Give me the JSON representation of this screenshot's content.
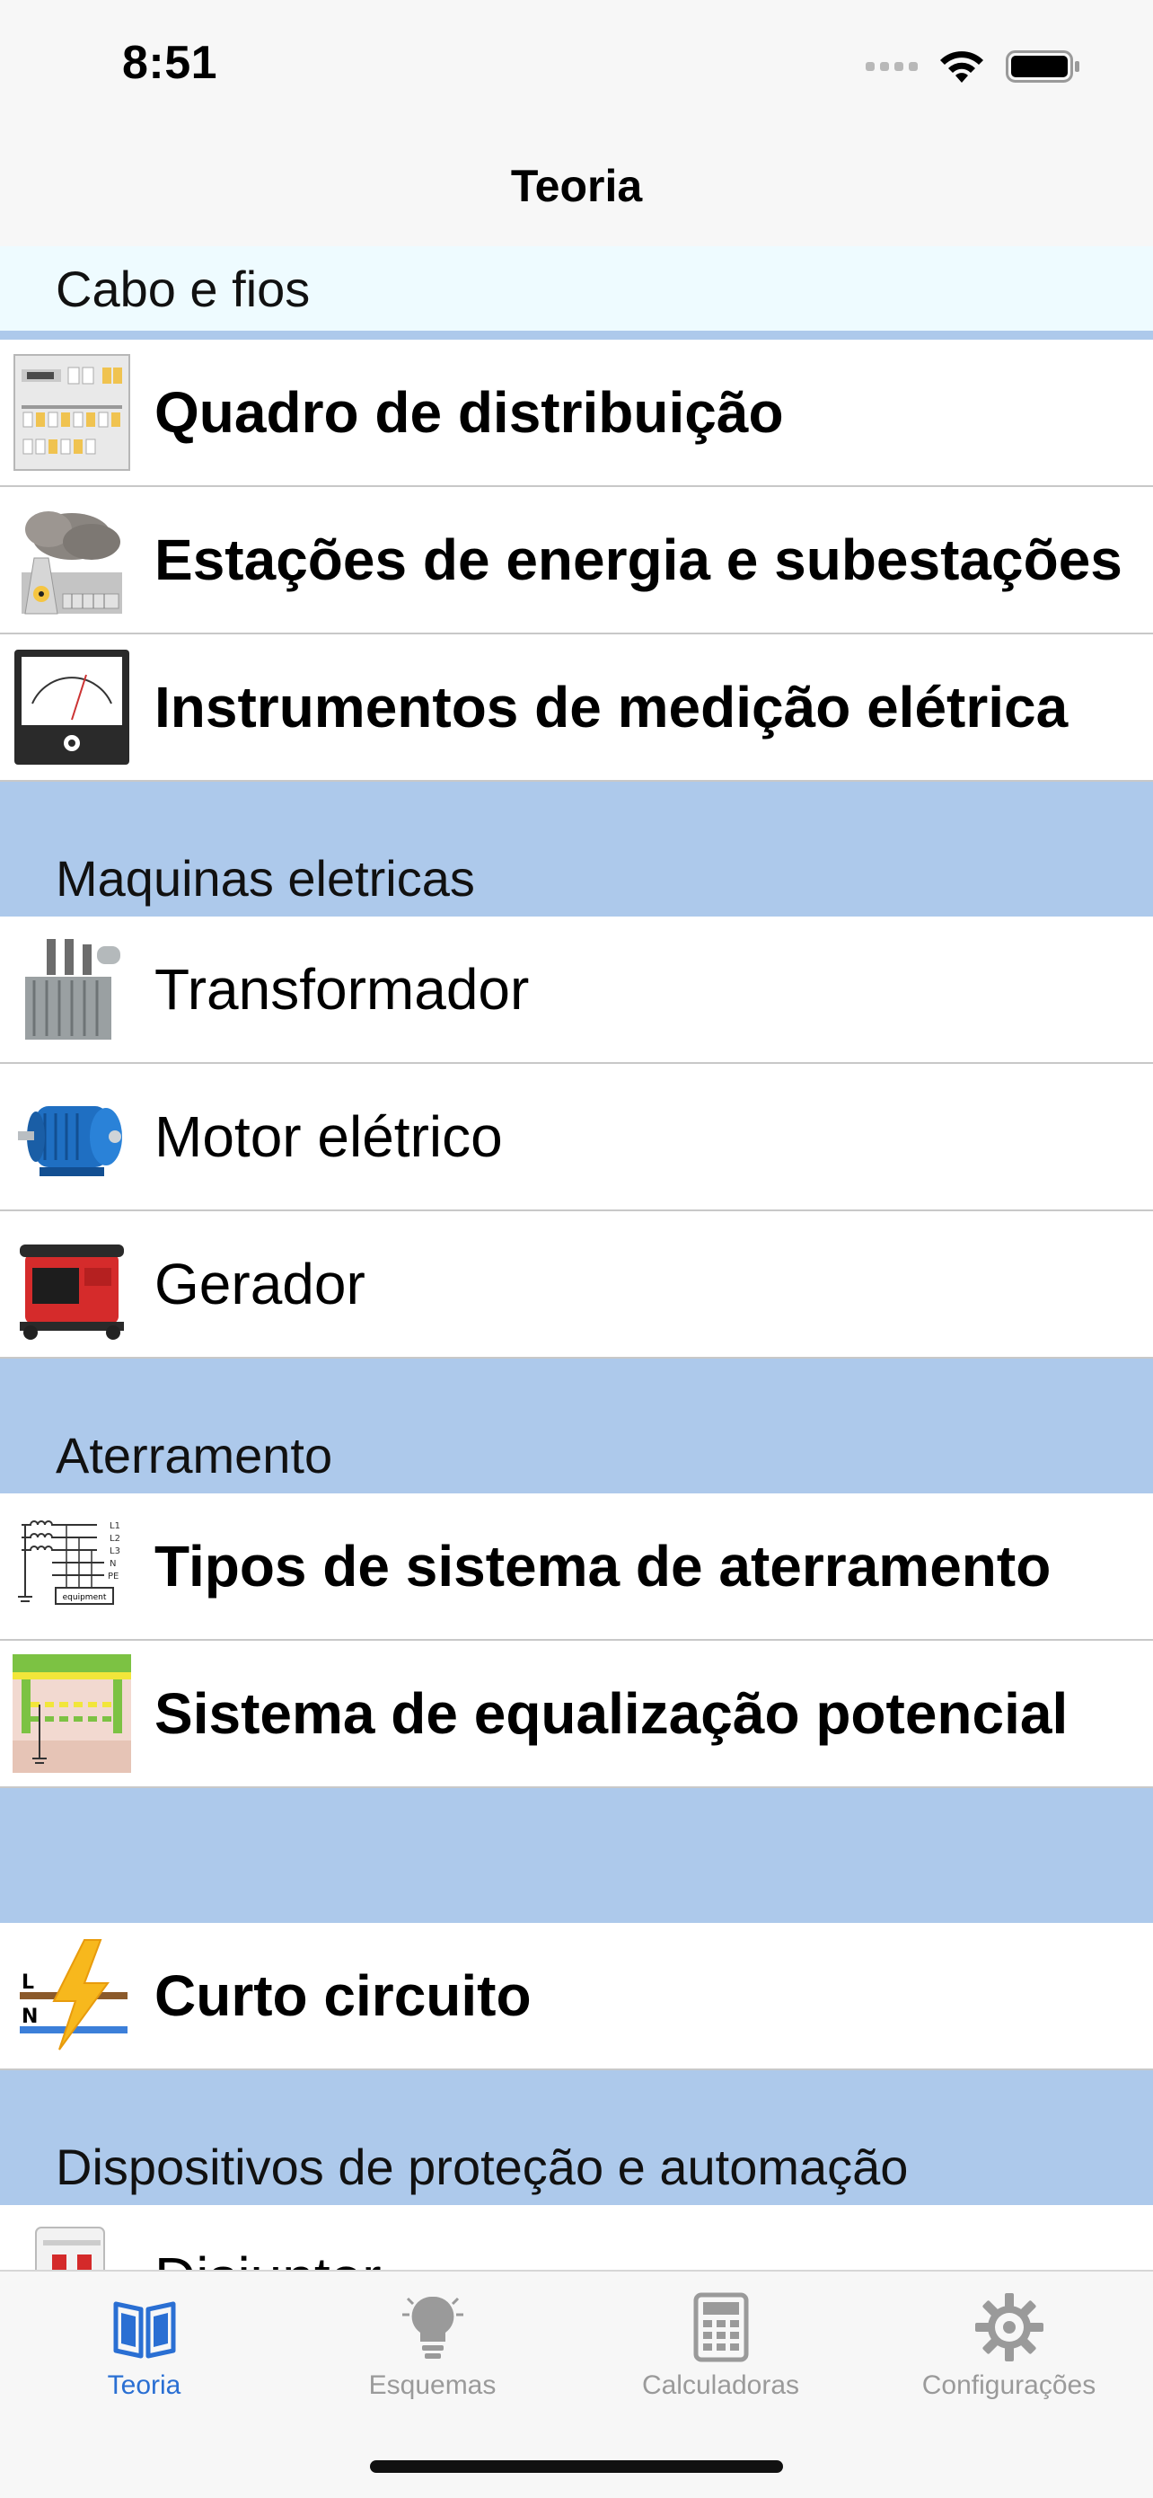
{
  "status": {
    "time": "8:51"
  },
  "nav": {
    "title": "Teoria"
  },
  "sections": {
    "cabo": {
      "label": "Cabo e fios"
    },
    "maquinas": {
      "label": "Maquinas eletricas"
    },
    "aterramento": {
      "label": "Aterramento"
    },
    "blank": {
      "label": ""
    },
    "dispositivos": {
      "label": "Dispositivos de proteção e automação"
    }
  },
  "rows": {
    "quadro": "Quadro de distribuição",
    "estacoes": "Estações de energia e subestações",
    "instrumentos": "Instrumentos de medição elétrica",
    "transformador": "Transformador",
    "motor": "Motor elétrico",
    "gerador": "Gerador",
    "tipos": "Tipos de sistema de aterramento",
    "equalizacao": "Sistema de equalização potencial",
    "curto": "Curto circuito",
    "disjuntor": "Disjuntor"
  },
  "thumb_text": {
    "l1": "L1",
    "l2": "L2",
    "l3": "L3",
    "n": "N",
    "pe": "PE",
    "equipment": "equipment",
    "sc_l": "L",
    "sc_n": "N"
  },
  "tabs": [
    {
      "label": "Teoria",
      "icon": "book-icon",
      "active": true
    },
    {
      "label": "Esquemas",
      "icon": "lightbulb-icon",
      "active": false
    },
    {
      "label": "Calculadoras",
      "icon": "calculator-icon",
      "active": false
    },
    {
      "label": "Configurações",
      "icon": "gear-icon",
      "active": false
    }
  ],
  "colors": {
    "section_header": "#adc9eb",
    "first_header": "#eefbff",
    "active_tab": "#2a6fd3",
    "inactive_tab": "#9a9a9a"
  }
}
